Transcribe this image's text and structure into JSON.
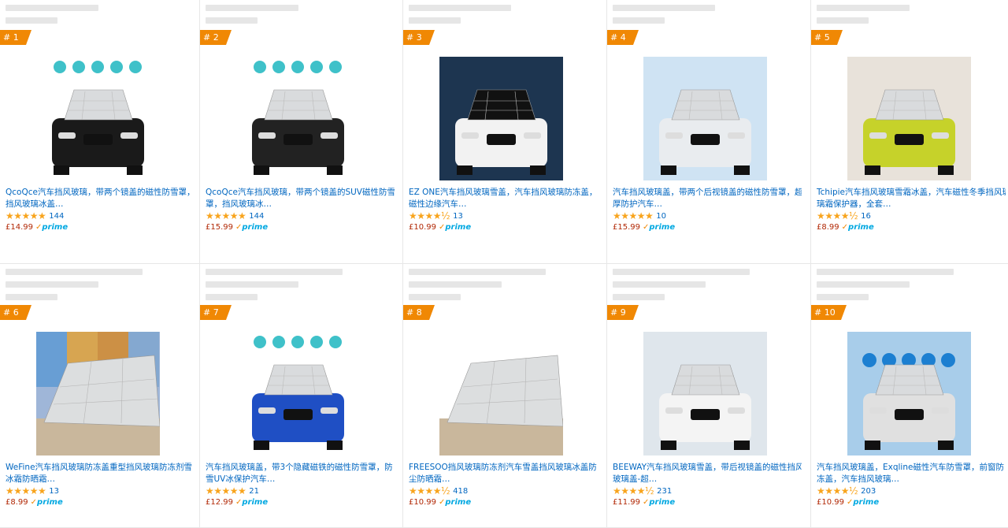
{
  "products": [
    {
      "rank": "# 1",
      "title_lines": [
        "QcoQce汽车挡风玻璃，带两个镜盖的磁性防雪罩，",
        "挡风玻璃冰盖…"
      ],
      "stars": "★★★★★",
      "reviews": "144",
      "price": "£14.99",
      "prime_label": "prime",
      "image": "black-bmw-suv-front-with-windshield-cover"
    },
    {
      "rank": "# 2",
      "title_lines": [
        "QcoQce汽车挡风玻璃，带两个镜盖的SUV磁性防雪",
        "罩，挡风玻璃冰…"
      ],
      "stars": "★★★★★",
      "reviews": "144",
      "price": "£15.99",
      "prime_label": "prime",
      "image": "black-vw-suv-front-with-windshield-cover"
    },
    {
      "rank": "# 3",
      "title_lines": [
        "EZ ONE汽车挡风玻璃雪盖，汽车挡风玻璃防冻盖，",
        "磁性边缘汽车…"
      ],
      "stars": "★★★★½",
      "reviews": "13",
      "price": "£10.99",
      "prime_label": "prime",
      "image": "white-audi-front-with-black-cover"
    },
    {
      "rank": "# 4",
      "title_lines": [
        "汽车挡风玻璃盖，带两个后视镜盖的磁性防雪罩，超",
        "厚防护汽车…"
      ],
      "stars": "★★★★★",
      "reviews": "10",
      "price": "£15.99",
      "prime_label": "prime",
      "image": "white-car-in-snow-with-silver-cover"
    },
    {
      "rank": "# 5",
      "title_lines": [
        "Tchipie汽车挡风玻璃雪霜冰盖，汽车磁性冬季挡风玻",
        "璃霜保护器，全套…"
      ],
      "stars": "★★★★½",
      "reviews": "16",
      "price": "£8.99",
      "prime_label": "prime",
      "image": "yellow-nissan-with-silver-cover"
    },
    {
      "rank": "# 6",
      "title_lines": [
        "WeFine汽车挡风玻璃防冻盖重型挡风玻璃防冻剂雪",
        "冰霜防晒霜…"
      ],
      "stars": "★★★★★",
      "reviews": "13",
      "price": "£8.99",
      "prime_label": "prime",
      "image": "four-seasons-cover-collage"
    },
    {
      "rank": "# 7",
      "title_lines": [
        "汽车挡风玻璃盖，带3个隐藏磁铁的磁性防雪罩，防",
        "雪UV冰保护汽车…"
      ],
      "stars": "★★★★★",
      "reviews": "21",
      "price": "£12.99",
      "prime_label": "prime",
      "image": "blue-nissan-with-silver-cover"
    },
    {
      "rank": "# 8",
      "title_lines": [
        "FREESOO挡风玻璃防冻剂汽车雪盖挡风玻璃冰盖防",
        "尘防晒霜…"
      ],
      "stars": "★★★★½",
      "reviews": "418",
      "price": "£10.99",
      "prime_label": "prime",
      "image": "quilted-silver-cover-on-windshield"
    },
    {
      "rank": "# 9",
      "title_lines": [
        "BEEWAY汽车挡风玻璃雪盖，带后视镜盖的磁性挡风",
        "玻璃盖-超…"
      ],
      "stars": "★★★★½",
      "reviews": "231",
      "price": "£11.99",
      "prime_label": "prime",
      "image": "white-car-snowy-trees-silver-cover"
    },
    {
      "rank": "# 10",
      "title_lines": [
        "汽车挡风玻璃盖，Exqline磁性汽车防雪罩，前窗防",
        "冻盖，汽车挡风玻璃…"
      ],
      "stars": "★★★★½",
      "reviews": "203",
      "price": "£10.99",
      "prime_label": "prime",
      "image": "snowy-house-car-cover-with-icons"
    }
  ],
  "colors": {
    "link": "#0066c0",
    "price": "#b12704",
    "rank_badge": "#f08804",
    "star": "#f8a41d",
    "prime": "#00a8e1"
  }
}
